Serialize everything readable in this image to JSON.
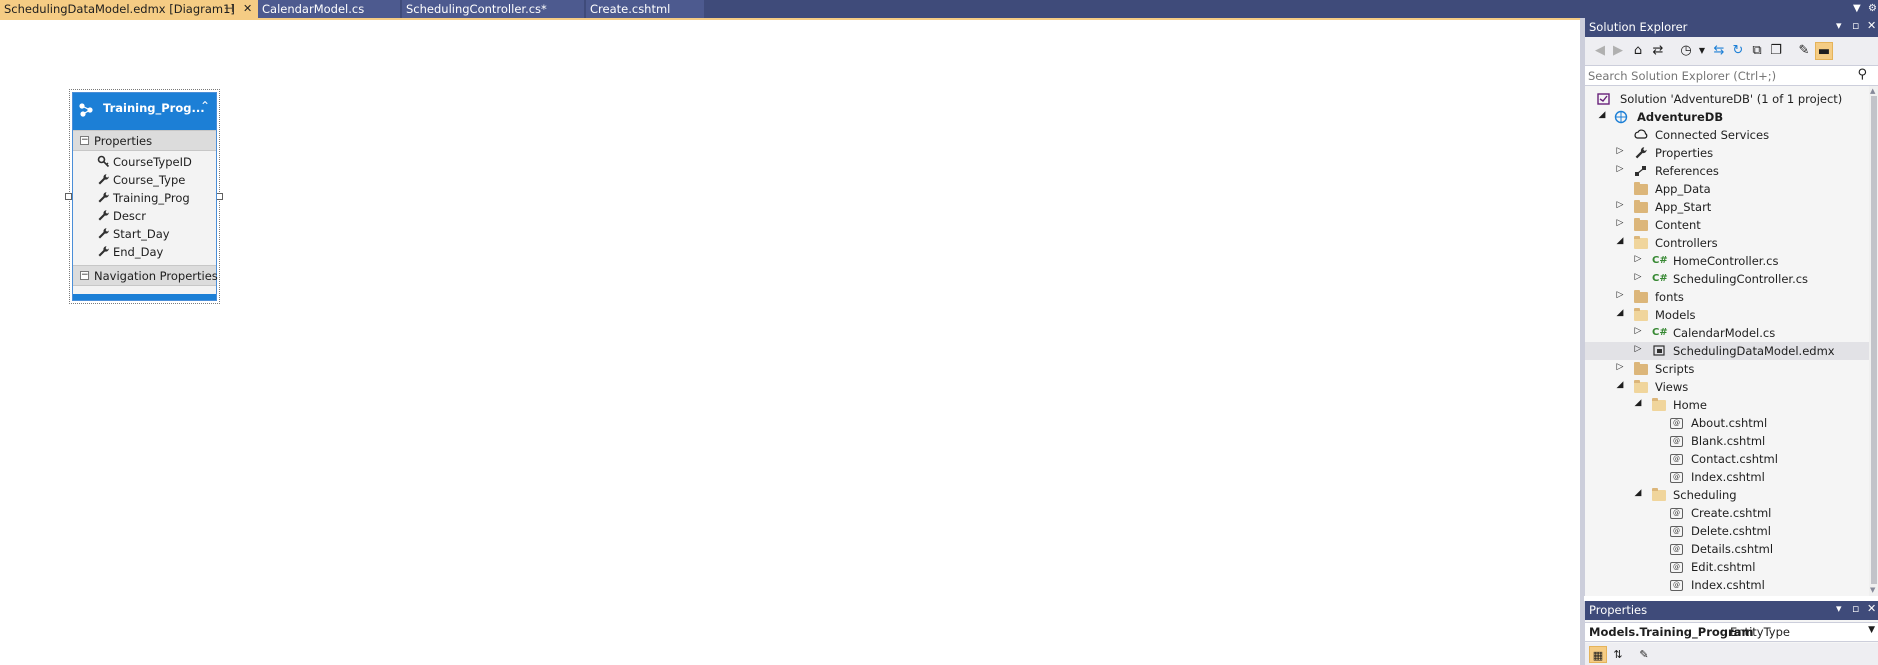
{
  "tabs": [
    {
      "label": "SchedulingDataModel.edmx [Diagram1]",
      "active": true,
      "pin_icon": "pin-icon",
      "close_icon": "close-icon"
    },
    {
      "label": "CalendarModel.cs",
      "active": false
    },
    {
      "label": "SchedulingController.cs*",
      "active": false
    },
    {
      "label": "Create.cshtml",
      "active": false
    }
  ],
  "designer": {
    "entity": {
      "title": "Training_Prog...",
      "sections": {
        "properties_label": "Properties",
        "navigation_label": "Navigation Properties"
      },
      "properties": [
        {
          "name": "CourseTypeID",
          "icon": "key-icon"
        },
        {
          "name": "Course_Type",
          "icon": "wrench-icon"
        },
        {
          "name": "Training_Prog",
          "icon": "wrench-icon"
        },
        {
          "name": "Descr",
          "icon": "wrench-icon"
        },
        {
          "name": "Start_Day",
          "icon": "wrench-icon"
        },
        {
          "name": "End_Day",
          "icon": "wrench-icon"
        }
      ]
    }
  },
  "solution_explorer": {
    "title": "Solution Explorer",
    "search_placeholder": "Search Solution Explorer (Ctrl+;)",
    "tree": [
      {
        "label": "Solution 'AdventureDB' (1 of 1 project)",
        "level": 0,
        "icon": "solution-icon"
      },
      {
        "label": "AdventureDB",
        "level": 0,
        "icon": "web-project-icon",
        "expanded": true,
        "bold": true
      },
      {
        "label": "Connected Services",
        "level": 1,
        "icon": "connected-services-icon"
      },
      {
        "label": "Properties",
        "level": 1,
        "icon": "wrench-icon",
        "expanded": false
      },
      {
        "label": "References",
        "level": 1,
        "icon": "references-icon",
        "expanded": false
      },
      {
        "label": "App_Data",
        "level": 1,
        "icon": "folder-icon"
      },
      {
        "label": "App_Start",
        "level": 1,
        "icon": "folder-icon",
        "expanded": false
      },
      {
        "label": "Content",
        "level": 1,
        "icon": "folder-icon",
        "expanded": false
      },
      {
        "label": "Controllers",
        "level": 1,
        "icon": "folder-open-icon",
        "expanded": true
      },
      {
        "label": "HomeController.cs",
        "level": 2,
        "icon": "csharp-file-icon",
        "expanded": false
      },
      {
        "label": "SchedulingController.cs",
        "level": 2,
        "icon": "csharp-file-icon",
        "expanded": false
      },
      {
        "label": "fonts",
        "level": 1,
        "icon": "folder-icon",
        "expanded": false
      },
      {
        "label": "Models",
        "level": 1,
        "icon": "folder-open-icon",
        "expanded": true
      },
      {
        "label": "CalendarModel.cs",
        "level": 2,
        "icon": "csharp-file-icon",
        "expanded": false
      },
      {
        "label": "SchedulingDataModel.edmx",
        "level": 2,
        "icon": "edmx-file-icon",
        "expanded": false,
        "selected": true
      },
      {
        "label": "Scripts",
        "level": 1,
        "icon": "folder-icon",
        "expanded": false
      },
      {
        "label": "Views",
        "level": 1,
        "icon": "folder-open-icon",
        "expanded": true
      },
      {
        "label": "Home",
        "level": 2,
        "icon": "folder-open-icon",
        "expanded": true
      },
      {
        "label": "About.cshtml",
        "level": 3,
        "icon": "cshtml-file-icon"
      },
      {
        "label": "Blank.cshtml",
        "level": 3,
        "icon": "cshtml-file-icon"
      },
      {
        "label": "Contact.cshtml",
        "level": 3,
        "icon": "cshtml-file-icon"
      },
      {
        "label": "Index.cshtml",
        "level": 3,
        "icon": "cshtml-file-icon"
      },
      {
        "label": "Scheduling",
        "level": 2,
        "icon": "folder-open-icon",
        "expanded": true
      },
      {
        "label": "Create.cshtml",
        "level": 3,
        "icon": "cshtml-file-icon"
      },
      {
        "label": "Delete.cshtml",
        "level": 3,
        "icon": "cshtml-file-icon"
      },
      {
        "label": "Details.cshtml",
        "level": 3,
        "icon": "cshtml-file-icon"
      },
      {
        "label": "Edit.cshtml",
        "level": 3,
        "icon": "cshtml-file-icon"
      },
      {
        "label": "Index.cshtml",
        "level": 3,
        "icon": "cshtml-file-icon"
      }
    ]
  },
  "properties_panel": {
    "title": "Properties",
    "object_name": "Models.Training_Program",
    "object_kind": "EntityType"
  },
  "colors": {
    "tab_active": "#f5cc84",
    "title_bar": "#3f4b7a",
    "entity_header": "#1c7fd6"
  }
}
